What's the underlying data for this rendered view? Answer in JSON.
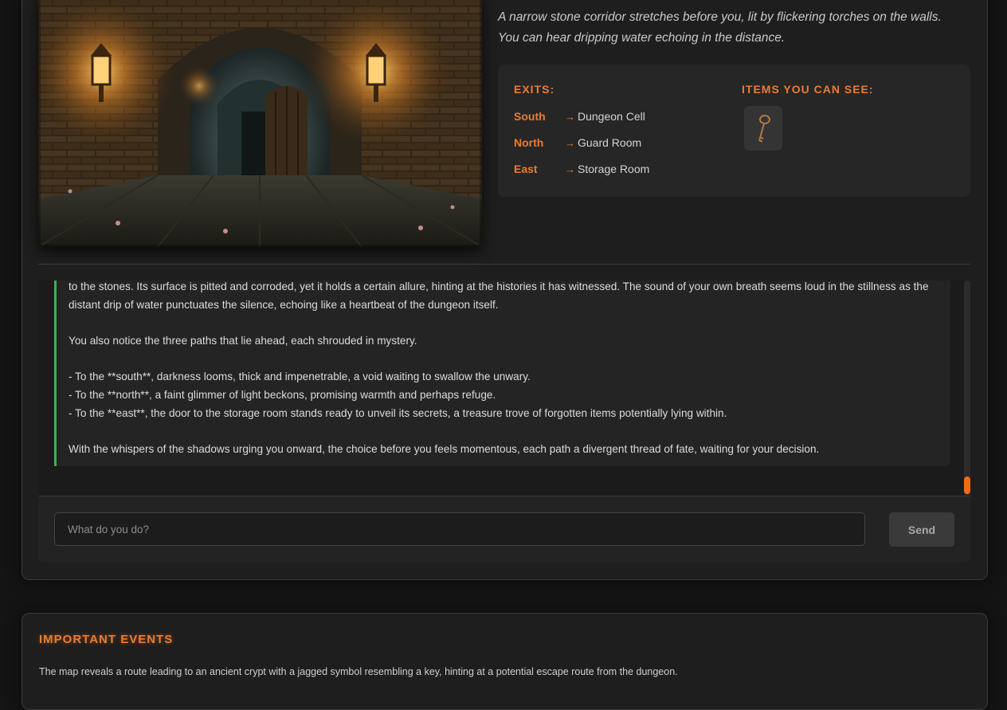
{
  "room": {
    "description": "A narrow stone corridor stretches before you, lit by flickering torches on the walls. You can hear dripping water echoing in the distance."
  },
  "exits": {
    "heading": "EXITS:",
    "list": [
      {
        "direction": "South",
        "arrow": "→",
        "destination": "Dungeon Cell"
      },
      {
        "direction": "North",
        "arrow": "→",
        "destination": "Guard Room"
      },
      {
        "direction": "East",
        "arrow": "→",
        "destination": "Storage Room"
      }
    ]
  },
  "items": {
    "heading": "ITEMS YOU CAN SEE:",
    "list": [
      {
        "icon": "key-icon"
      }
    ]
  },
  "log": {
    "paragraphs": [
      "to the stones. Its surface is pitted and corroded, yet it holds a certain allure, hinting at the histories it has witnessed. The sound of your own breath seems loud in the stillness as the distant drip of water punctuates the silence, echoing like a heartbeat of the dungeon itself.",
      "You also notice the three paths that lie ahead, each shrouded in mystery.",
      "- To the **south**, darkness looms, thick and impenetrable, a void waiting to swallow the unwary.",
      "- To the **north**, a faint glimmer of light beckons, promising warmth and perhaps refuge.",
      "- To the **east**, the door to the storage room stands ready to unveil its secrets, a treasure trove of forgotten items potentially lying within.",
      "With the whispers of the shadows urging you onward, the choice before you feels momentous, each path a divergent thread of fate, waiting for your decision."
    ]
  },
  "input": {
    "placeholder": "What do you do?",
    "value": "",
    "send_label": "Send"
  },
  "events": {
    "heading": "IMPORTANT EVENTS",
    "items": [
      "The map reveals a route leading to an ancient crypt with a jagged symbol resembling a key, hinting at a potential escape route from the dungeon."
    ]
  },
  "colors": {
    "accent": "#ef7a2f",
    "log_border": "#3fae4d",
    "scroll_thumb": "#f26b13",
    "panel": "#1e1e1e",
    "background": "#141414"
  }
}
